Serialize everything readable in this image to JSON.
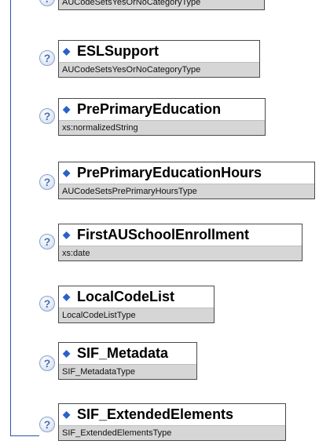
{
  "diagram": {
    "partial_top_type": "AUCodeSetsYesOrNoCategoryType",
    "help_symbol": "?",
    "element_icon": "element-icon",
    "line_color": "#2a55a8",
    "nodes": [
      {
        "name": "ESLSupport",
        "type": "AUCodeSetsYesOrNoCategoryType"
      },
      {
        "name": "PrePrimaryEducation",
        "type": "xs:normalizedString"
      },
      {
        "name": "PrePrimaryEducationHours",
        "type": "AUCodeSetsPrePrimaryHoursType"
      },
      {
        "name": "FirstAUSchoolEnrollment",
        "type": "xs:date"
      },
      {
        "name": "LocalCodeList",
        "type": "LocalCodeListType"
      },
      {
        "name": "SIF_Metadata",
        "type": "SIF_MetadataType"
      },
      {
        "name": "SIF_ExtendedElements",
        "type": "SIF_ExtendedElementsType"
      }
    ]
  }
}
